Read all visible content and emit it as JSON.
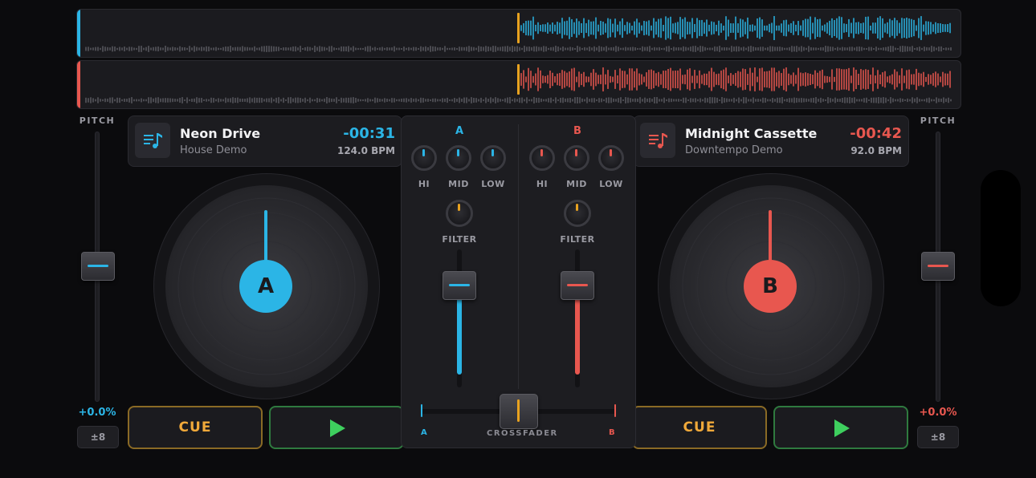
{
  "colors": {
    "deck_a": "#2bb5e6",
    "deck_b": "#e8574f",
    "cue": "#f0a93a",
    "play": "#3ecf5e",
    "playhead": "#e8a21f"
  },
  "deck_a": {
    "pitch_label": "PITCH",
    "pitch_value": "+0.0%",
    "pitch_range": "±8",
    "track_title": "Neon Drive",
    "artist": "House Demo",
    "time_remaining": "-00:31",
    "bpm": "124.0 BPM",
    "platter_label": "A",
    "cue_label": "CUE",
    "play_icon": "play-icon",
    "art_icon": "music-playlist-icon"
  },
  "deck_b": {
    "pitch_label": "PITCH",
    "pitch_value": "+0.0%",
    "pitch_range": "±8",
    "track_title": "Midnight Cassette",
    "artist": "Downtempo Demo",
    "time_remaining": "-00:42",
    "bpm": "92.0 BPM",
    "platter_label": "B",
    "cue_label": "CUE",
    "play_icon": "play-icon",
    "art_icon": "music-playlist-icon"
  },
  "mixer": {
    "channel_a": {
      "letter": "A",
      "eq_labels": [
        "HI",
        "MID",
        "LOW"
      ],
      "filter_label": "FILTER",
      "volume_level": 0.8
    },
    "channel_b": {
      "letter": "B",
      "eq_labels": [
        "HI",
        "MID",
        "LOW"
      ],
      "filter_label": "FILTER",
      "volume_level": 0.8
    },
    "crossfader": {
      "label": "CROSSFADER",
      "left_label": "A",
      "right_label": "B",
      "position": 0.5
    }
  },
  "waveforms": {
    "deck_a_progress": 0.5,
    "deck_b_progress": 0.5
  }
}
